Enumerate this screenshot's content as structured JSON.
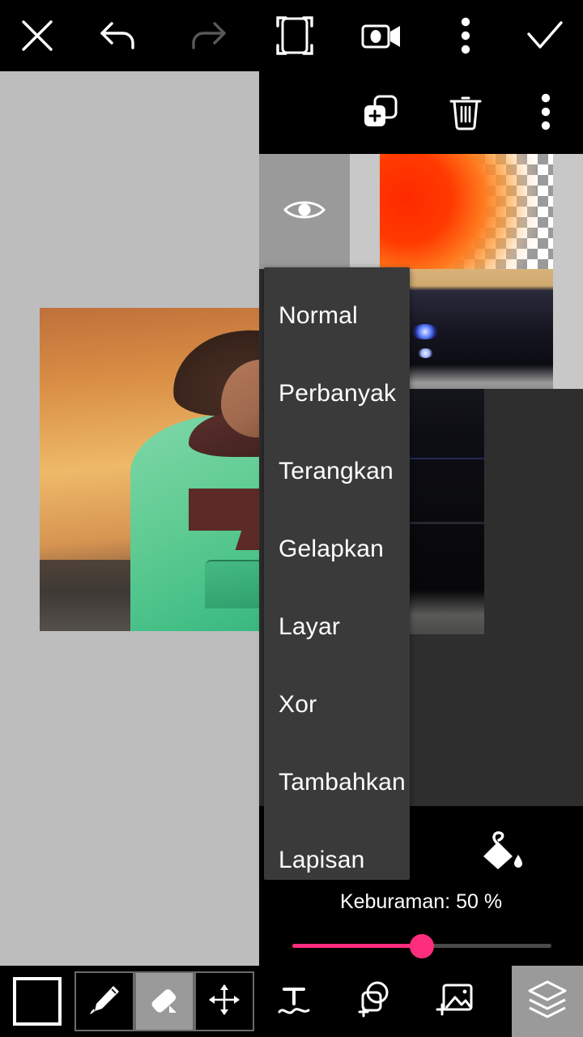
{
  "app": {
    "canvas_bg": "#bdbdbd",
    "panel_bg": "#2e2e2e",
    "accent": "#ff2d7e"
  },
  "topbar": {
    "items": [
      {
        "name": "close-icon",
        "label": "Tutup"
      },
      {
        "name": "undo-icon",
        "label": "Urungkan"
      },
      {
        "name": "redo-icon",
        "label": "Ulangi"
      },
      {
        "name": "crop-frame-icon",
        "label": "Pangkas"
      },
      {
        "name": "video-camera-icon",
        "label": "Rekam"
      },
      {
        "name": "more-vertical-icon",
        "label": "Lainnya"
      },
      {
        "name": "check-icon",
        "label": "Selesai"
      }
    ]
  },
  "layer_panel": {
    "toolbar": [
      {
        "name": "add-layer-icon",
        "label": "Tambah Lapisan"
      },
      {
        "name": "delete-layer-icon",
        "label": "Hapus"
      },
      {
        "name": "layer-more-icon",
        "label": "Lainnya"
      }
    ],
    "layers": [
      {
        "name": "layer-row-1",
        "thumb": "orange-gradient-transparent",
        "visible": true,
        "selected": true,
        "visibility_label": "Terlihat"
      },
      {
        "name": "layer-row-2",
        "thumb": "blue-camaro-photo",
        "visible": true,
        "selected": false,
        "visibility_label": "Terlihat"
      },
      {
        "name": "layer-row-3",
        "thumb": "dark-car-closeup",
        "visible": true,
        "selected": false,
        "visibility_label": "Terlihat"
      }
    ]
  },
  "blend_menu": {
    "open": true,
    "selected": "Normal",
    "items": [
      "Normal",
      "Perbanyak",
      "Terangkan",
      "Gelapkan",
      "Layar",
      "Xor",
      "Tambahkan",
      "Lapisan"
    ]
  },
  "opacity": {
    "label": "Keburaman:  50 %",
    "value": 50,
    "fill_color": "#ff2d7e",
    "track_color": "#4a4a4a",
    "bucket_icon": "paint-bucket-icon"
  },
  "bottombar": {
    "color_swatch": {
      "name": "color-swatch",
      "color": "#000000"
    },
    "tools": [
      {
        "name": "brush-tool",
        "label": "Kuas",
        "active": false
      },
      {
        "name": "eraser-tool",
        "label": "Penghapus",
        "active": true
      },
      {
        "name": "move-tool",
        "label": "Pindah",
        "active": false
      }
    ],
    "extras": [
      {
        "name": "text-tool",
        "label": "Teks"
      },
      {
        "name": "add-shape-tool",
        "label": "Bentuk"
      },
      {
        "name": "add-image-tool",
        "label": "Gambar"
      }
    ],
    "layers_button": {
      "name": "layers-button",
      "label": "Lapisan",
      "active": true
    }
  },
  "canvas": {
    "photo_alt": "Pria berjaket hoodie hijau dengan latar matahari terbenam"
  }
}
